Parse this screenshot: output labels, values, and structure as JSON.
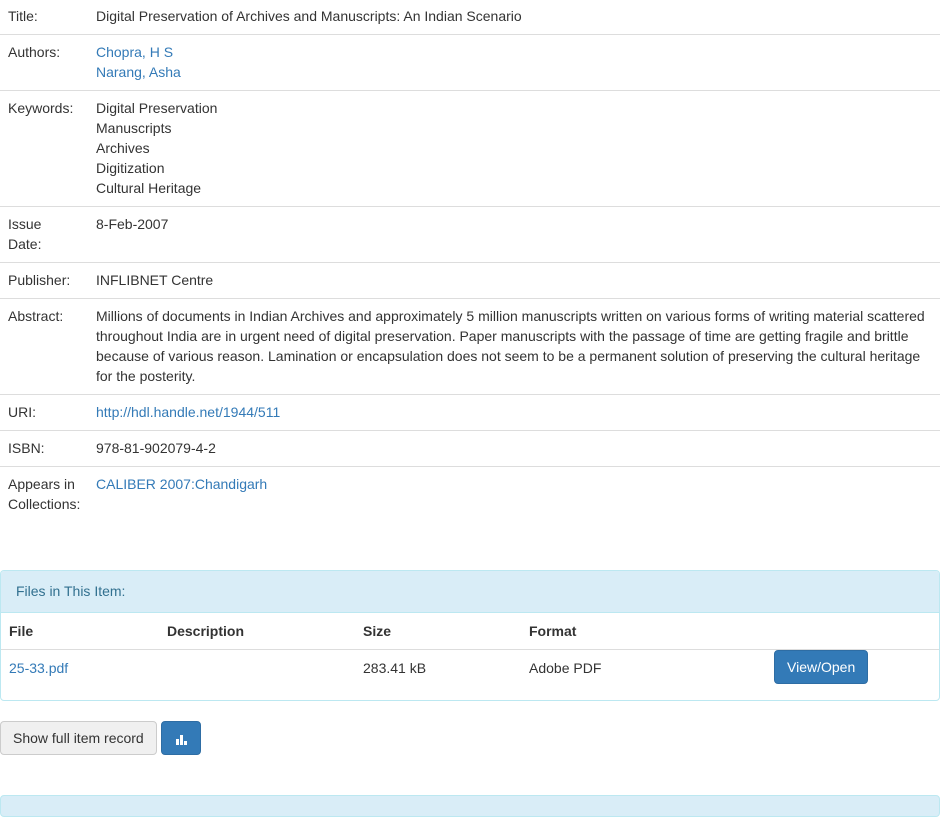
{
  "metadata": {
    "title": {
      "label": "Title:",
      "value": "Digital Preservation of Archives and Manuscripts: An Indian Scenario"
    },
    "authors": {
      "label": "Authors:",
      "values": [
        "Chopra, H S",
        "Narang, Asha"
      ]
    },
    "keywords": {
      "label": "Keywords:",
      "values": [
        "Digital Preservation",
        "Manuscripts",
        "Archives",
        "Digitization",
        "Cultural Heritage"
      ]
    },
    "issue_date": {
      "label_line1": "Issue",
      "label_line2": "Date:",
      "value": "8-Feb-2007"
    },
    "publisher": {
      "label": "Publisher:",
      "value": "INFLIBNET Centre"
    },
    "abstract": {
      "label": "Abstract:",
      "value": "Millions of documents in Indian Archives and approximately 5 million manuscripts written on various forms of writing material scattered throughout India are in urgent need of digital preservation. Paper manuscripts with the passage of time are getting fragile and brittle because of various reason. Lamination or encapsulation does not seem to be a permanent solution of preserving the cultural heritage for the posterity."
    },
    "uri": {
      "label": "URI:",
      "value": "http://hdl.handle.net/1944/511"
    },
    "isbn": {
      "label": "ISBN:",
      "value": "978-81-902079-4-2"
    },
    "collections": {
      "label_line1": "Appears in",
      "label_line2": "Collections:",
      "value": "CALIBER 2007:Chandigarh"
    }
  },
  "files_panel": {
    "heading": "Files in This Item:",
    "columns": [
      "File",
      "Description",
      "Size",
      "Format"
    ],
    "rows": [
      {
        "file": "25-33.pdf",
        "description": "",
        "size": "283.41 kB",
        "format": "Adobe PDF",
        "action": "View/Open"
      }
    ]
  },
  "buttons": {
    "full_record": "Show full item record",
    "stats_icon": "bar-chart-icon"
  },
  "colors": {
    "link": "#337ab7",
    "primary": "#337ab7",
    "panel_heading_bg": "#d9edf7",
    "panel_heading_text": "#31708f"
  }
}
